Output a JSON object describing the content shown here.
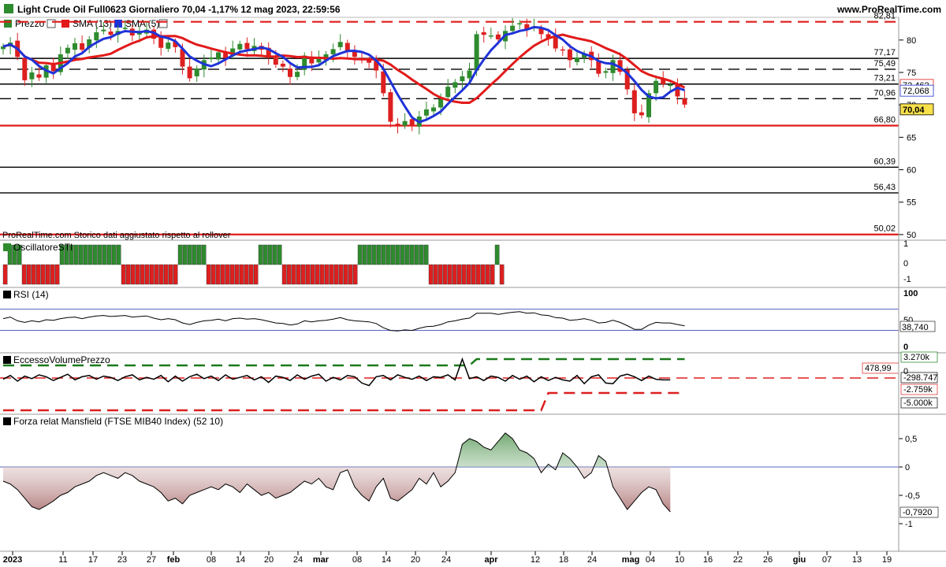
{
  "header": {
    "title": "Light Crude Oil Full0623 Giornaliero 70,04 -1,17% 12 mag 2023, 22:59:56",
    "site": "www.ProRealTime.com"
  },
  "colors": {
    "up": "#2e8b2e",
    "down": "#dd1f1f",
    "sma13": "#e21a1a",
    "sma5": "#1f33d8",
    "level_red": "#e21a1a",
    "level_black": "#000000",
    "grid": "#cfcfcf",
    "mansfield_neg": "#a86a6a",
    "mansfield_pos": "#5a9a5a"
  },
  "legend": [
    {
      "label": "Prezzo",
      "color": "#2e8b2e",
      "icon": "candle-icon"
    },
    {
      "label": "SMA (13)",
      "color": "#e21a1a",
      "icon": "line-icon"
    },
    {
      "label": "SMA (5)",
      "color": "#1f33d8",
      "icon": "line-icon"
    }
  ],
  "note": "ProRealTime.com  Storico dati aggiustato rispetto al rollover",
  "price_badges": [
    {
      "value": "72,462",
      "color": "#e21a1a"
    },
    {
      "value": "72,068",
      "color": "#1f33d8"
    },
    {
      "value": "70,04",
      "color": "#000000",
      "bg": "#f7e04a"
    }
  ],
  "panels": {
    "sti": {
      "title": "OscillatoreSTI",
      "ticks": [
        "1",
        "0",
        "-1"
      ],
      "last": "-1"
    },
    "rsi": {
      "title": "RSI (14)",
      "ticks": [
        "100",
        "50",
        "0"
      ],
      "last": "38,740"
    },
    "evp": {
      "title": "EccessoVolumePrezzo",
      "badges": [
        "3.270k",
        "478,99",
        "-298.747",
        "-2.759k",
        "-5.000k"
      ],
      "tick_mid": "0"
    },
    "mansfield": {
      "title": "Forza relat Mansfield (FTSE MIB40 Index) (52 10)",
      "ticks": [
        "0,5",
        "0",
        "-0,5",
        "-1"
      ],
      "last": "-0,7920"
    }
  },
  "chart_data": {
    "type": "candlestick",
    "title": "Light Crude Oil Full0623 Giornaliero",
    "x_axis_labels": [
      "2023",
      "11",
      "17",
      "23",
      "27",
      "feb",
      "08",
      "14",
      "20",
      "24",
      "mar",
      "08",
      "14",
      "20",
      "24",
      "apr",
      "12",
      "18",
      "24",
      "mag",
      "04",
      "10",
      "16",
      "22",
      "26",
      "giu",
      "07",
      "13",
      "19"
    ],
    "y_ticks": [
      50,
      55,
      60,
      65,
      70,
      75,
      80
    ],
    "ylim": [
      49.5,
      83.5
    ],
    "horizontal_levels": [
      {
        "value": 82.81,
        "label": "82,81",
        "style": "red-dashed"
      },
      {
        "value": 77.17,
        "label": "77,17",
        "style": "black-solid"
      },
      {
        "value": 75.49,
        "label": "75,49",
        "style": "black-dashed"
      },
      {
        "value": 73.21,
        "label": "73,21",
        "style": "black-solid"
      },
      {
        "value": 70.96,
        "label": "70,96",
        "style": "black-dashed"
      },
      {
        "value": 66.8,
        "label": "66,80",
        "style": "red-solid"
      },
      {
        "value": 60.39,
        "label": "60,39",
        "style": "black-solid"
      },
      {
        "value": 56.43,
        "label": "56,43",
        "style": "black-solid"
      },
      {
        "value": 50.02,
        "label": "50,02",
        "style": "red-solid"
      }
    ],
    "closes": [
      79.0,
      79.6,
      77.4,
      73.8,
      75.0,
      74.2,
      76.1,
      75.2,
      77.8,
      78.8,
      79.5,
      78.5,
      80.1,
      81.2,
      81.6,
      80.8,
      81.4,
      81.9,
      80.7,
      81.3,
      81.6,
      80.2,
      78.8,
      79.6,
      78.9,
      75.9,
      74.1,
      75.6,
      76.9,
      77.3,
      78.1,
      77.2,
      78.7,
      79.4,
      78.6,
      79.1,
      78.5,
      77.4,
      76.2,
      75.9,
      74.3,
      75.1,
      77.6,
      76.4,
      77.2,
      77.8,
      78.6,
      79.7,
      78.2,
      77.4,
      76.9,
      76.5,
      75.3,
      71.8,
      67.4,
      66.8,
      67.5,
      66.8,
      68.2,
      69.3,
      69.6,
      70.9,
      72.8,
      73.5,
      74.4,
      75.3,
      80.9,
      80.8,
      80.7,
      80.1,
      81.4,
      82.2,
      82.6,
      81.7,
      82.1,
      80.9,
      80.3,
      78.7,
      78.4,
      76.9,
      77.3,
      77.9,
      76.9,
      74.8,
      75.2,
      76.9,
      75.1,
      72.4,
      68.7,
      68.4,
      71.8,
      73.7,
      73.2,
      73.1,
      71.3,
      70.04
    ],
    "sma13_last": 72.462,
    "sma5_last": 72.068,
    "last_price": 70.04,
    "sti": [
      -1,
      1,
      1,
      1,
      -1,
      -1,
      -1,
      -1,
      -1,
      -1,
      -1,
      -1,
      1,
      1,
      1,
      1,
      1,
      1,
      1,
      1,
      1,
      1,
      1,
      1,
      1,
      -1,
      -1,
      -1,
      -1,
      -1,
      -1,
      -1,
      -1,
      -1,
      -1,
      -1,
      -1,
      1,
      1,
      1,
      1,
      1,
      1,
      -1,
      -1,
      -1,
      -1,
      -1,
      -1,
      -1,
      -1,
      -1,
      -1,
      -1,
      1,
      1,
      1,
      1,
      1,
      -1,
      -1,
      -1,
      -1,
      -1,
      -1,
      -1,
      -1,
      -1,
      -1,
      -1,
      -1,
      -1,
      -1,
      -1,
      -1,
      1,
      1,
      1,
      1,
      1,
      1,
      1,
      1,
      1,
      1,
      1,
      1,
      1,
      1,
      1,
      -1,
      -1,
      -1,
      -1,
      -1,
      -1,
      -1,
      -1,
      -1,
      -1,
      -1,
      -1,
      -1,
      -1,
      1,
      -1
    ],
    "rsi": [
      52,
      55,
      48,
      45,
      48,
      46,
      50,
      49,
      52,
      54,
      55,
      52,
      55,
      57,
      58,
      56,
      57,
      58,
      55,
      56,
      57,
      53,
      50,
      52,
      50,
      44,
      41,
      45,
      48,
      49,
      51,
      48,
      52,
      53,
      51,
      52,
      50,
      47,
      44,
      43,
      40,
      42,
      48,
      46,
      48,
      49,
      51,
      54,
      50,
      48,
      47,
      46,
      43,
      35,
      30,
      29,
      31,
      30,
      34,
      37,
      38,
      41,
      46,
      48,
      51,
      53,
      62,
      62,
      62,
      60,
      62,
      64,
      65,
      62,
      63,
      59,
      58,
      54,
      53,
      49,
      50,
      52,
      49,
      44,
      45,
      49,
      45,
      39,
      32,
      32,
      40,
      45,
      44,
      44,
      41,
      38.74
    ],
    "evp_upper": [
      2500,
      2500,
      2500,
      2500,
      2500,
      2500,
      2500,
      2500,
      2500,
      2500,
      2500,
      2500,
      2500,
      2500,
      2500,
      2500,
      2500,
      2500,
      2500,
      2500,
      2500,
      2500,
      2500,
      2500,
      2500,
      2500,
      2500,
      2500,
      2500,
      2500,
      2500,
      2500,
      2500,
      2500,
      2500,
      2500,
      2500,
      2500,
      2500,
      2500,
      2500,
      2500,
      2500,
      2500,
      2500,
      2500,
      2500,
      2500,
      2500,
      2500,
      2500,
      2500,
      2500,
      2500,
      2500,
      2500,
      2500,
      2500,
      2500,
      2500,
      2500,
      2500,
      2500,
      2500,
      2500,
      2500,
      3270,
      3270,
      3270,
      3270,
      3270,
      3270,
      3270,
      3270,
      3270,
      3270,
      3270,
      3270,
      3270,
      3270,
      3270,
      3270,
      3270,
      3270,
      3270,
      3270,
      3270,
      3270,
      3270,
      3270,
      3270,
      3270,
      3270,
      3270,
      3270,
      3270
    ],
    "evp_lower": [
      -4500,
      -4500,
      -4500,
      -4500,
      -4500,
      -4500,
      -4500,
      -4500,
      -4500,
      -4500,
      -4500,
      -4500,
      -4500,
      -4500,
      -4500,
      -4500,
      -4500,
      -4500,
      -4500,
      -4500,
      -4500,
      -4500,
      -4500,
      -4500,
      -4500,
      -4500,
      -4500,
      -4500,
      -4500,
      -4500,
      -4500,
      -4500,
      -4500,
      -4500,
      -4500,
      -4500,
      -4500,
      -4500,
      -4500,
      -4500,
      -4500,
      -4500,
      -4500,
      -4500,
      -4500,
      -4500,
      -4500,
      -4500,
      -4500,
      -4500,
      -4500,
      -4500,
      -4500,
      -4500,
      -4500,
      -4500,
      -4500,
      -4500,
      -4500,
      -4500,
      -4500,
      -4500,
      -4500,
      -4500,
      -4500,
      -4500,
      -4500,
      -4500,
      -4500,
      -4500,
      -4500,
      -4500,
      -4500,
      -4500,
      -4500,
      -4500,
      -2759,
      -2759,
      -2759,
      -2759,
      -2759,
      -2759,
      -2759,
      -2759,
      -2759,
      -2759,
      -2759,
      -2759,
      -2759,
      -2759,
      -2759,
      -2759,
      -2759,
      -2759,
      -2759,
      -2759
    ],
    "evp": [
      -200,
      400,
      -500,
      300,
      -100,
      500,
      200,
      -400,
      100,
      600,
      -300,
      200,
      400,
      -200,
      300,
      100,
      -400,
      200,
      500,
      -300,
      100,
      -200,
      400,
      -600,
      300,
      -500,
      200,
      600,
      -100,
      300,
      -400,
      500,
      -200,
      100,
      400,
      -300,
      200,
      -700,
      300,
      100,
      -400,
      500,
      -200,
      300,
      600,
      -500,
      100,
      -300,
      400,
      200,
      -800,
      -1200,
      200,
      400,
      -300,
      500,
      100,
      -200,
      300,
      -400,
      200,
      100,
      500,
      -300,
      3000,
      -100,
      200,
      -400,
      300,
      100,
      -500,
      400,
      -200,
      300,
      -600,
      200,
      -400,
      100,
      -300,
      -500,
      400,
      -900,
      200,
      500,
      -800,
      -900,
      300,
      600,
      200,
      -400,
      300,
      -200,
      -300,
      -298.747
    ],
    "mansfield": [
      -0.25,
      -0.3,
      -0.4,
      -0.55,
      -0.7,
      -0.75,
      -0.68,
      -0.6,
      -0.5,
      -0.45,
      -0.35,
      -0.3,
      -0.25,
      -0.15,
      -0.1,
      -0.15,
      -0.2,
      -0.1,
      -0.15,
      -0.25,
      -0.3,
      -0.35,
      -0.45,
      -0.6,
      -0.55,
      -0.65,
      -0.5,
      -0.45,
      -0.4,
      -0.35,
      -0.4,
      -0.3,
      -0.35,
      -0.45,
      -0.3,
      -0.4,
      -0.5,
      -0.45,
      -0.55,
      -0.5,
      -0.45,
      -0.35,
      -0.25,
      -0.3,
      -0.2,
      -0.35,
      -0.4,
      -0.1,
      -0.05,
      -0.35,
      -0.5,
      -0.6,
      -0.35,
      -0.2,
      -0.55,
      -0.6,
      -0.5,
      -0.4,
      -0.2,
      -0.3,
      -0.1,
      -0.35,
      -0.25,
      -0.1,
      0.4,
      0.5,
      0.45,
      0.35,
      0.3,
      0.45,
      0.6,
      0.5,
      0.3,
      0.25,
      0.15,
      -0.1,
      0.05,
      -0.05,
      0.25,
      0.15,
      0.0,
      -0.2,
      -0.1,
      0.2,
      0.1,
      -0.35,
      -0.55,
      -0.75,
      -0.6,
      -0.45,
      -0.35,
      -0.4,
      -0.65,
      -0.792
    ]
  }
}
